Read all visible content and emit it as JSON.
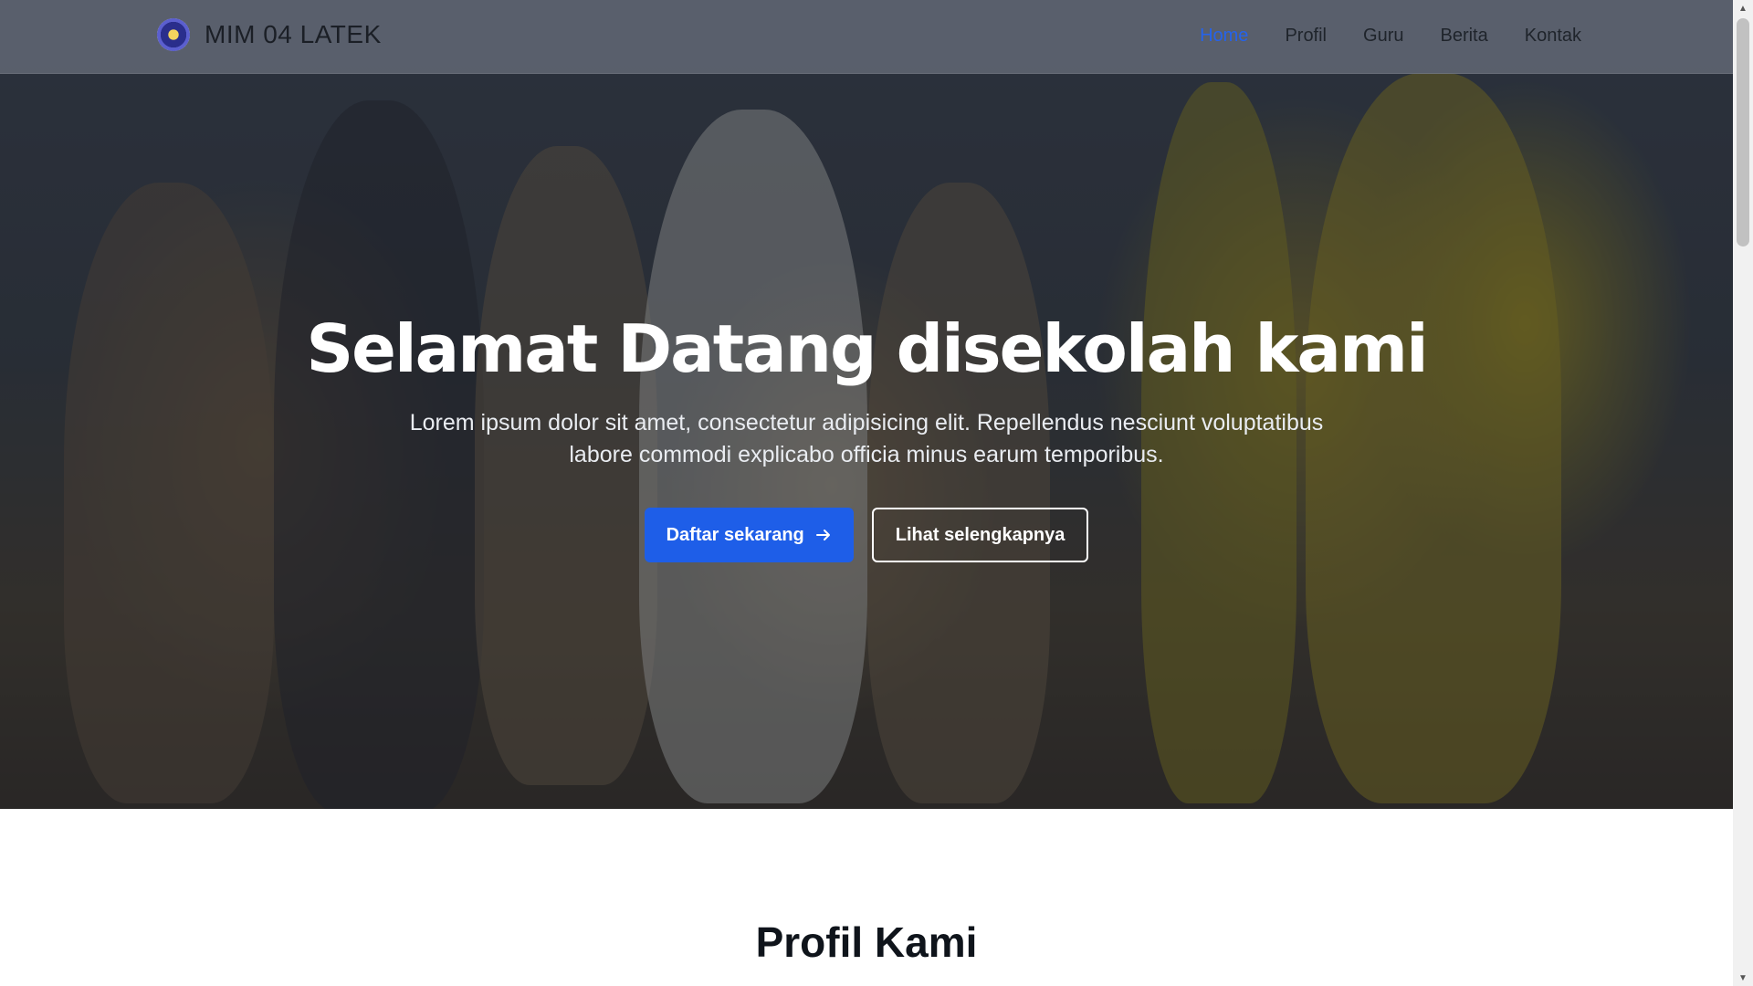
{
  "brand": {
    "name": "MIM 04 LATEK",
    "logo_icon": "school-emblem-icon"
  },
  "nav": {
    "items": [
      {
        "label": "Home",
        "active": true
      },
      {
        "label": "Profil"
      },
      {
        "label": "Guru"
      },
      {
        "label": "Berita"
      },
      {
        "label": "Kontak"
      }
    ]
  },
  "hero": {
    "title": "Selamat Datang disekolah kami",
    "subtitle": "Lorem ipsum dolor sit amet, consectetur adipisicing elit. Repellendus nesciunt voluptatibus labore commodi explicabo officia minus earum temporibus.",
    "primary_button": "Daftar sekarang",
    "primary_button_icon": "arrow-right-icon",
    "secondary_button": "Lihat selengkapnya"
  },
  "section": {
    "title": "Profil Kami"
  },
  "colors": {
    "accent": "#1e5ee8",
    "nav_active": "#2563eb"
  }
}
